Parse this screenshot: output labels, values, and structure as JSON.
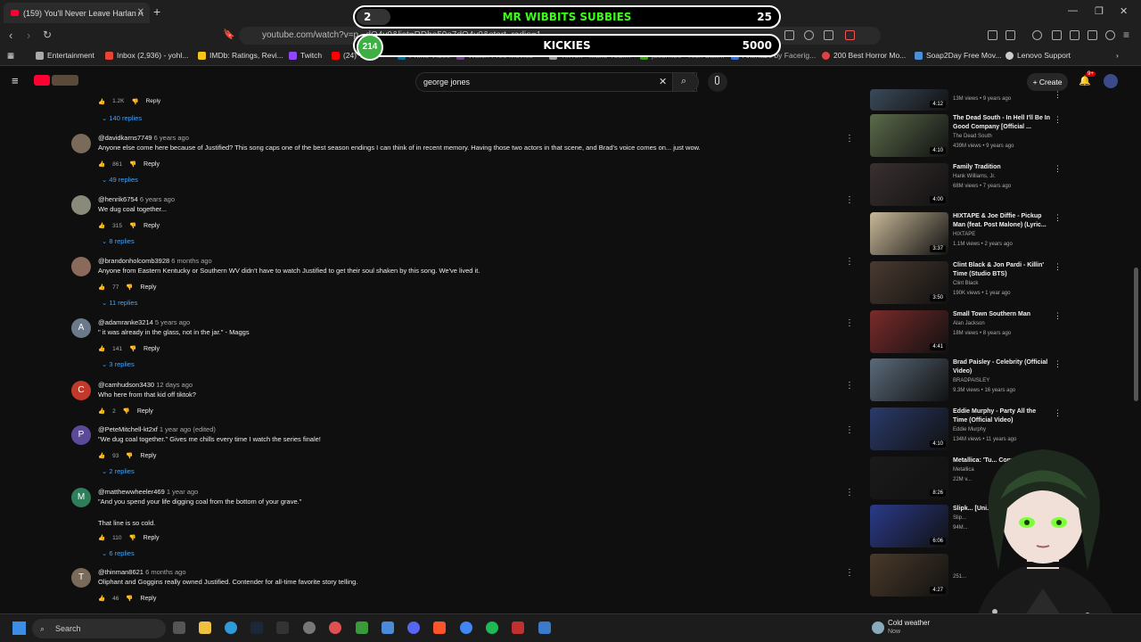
{
  "browser": {
    "tab_title": "(159) You'll Never Leave Harlan A",
    "url": "youtube.com/watch?v=p...dO4v0&list=RDhe50e7dO4v0&start_radio=1",
    "bookmarks": [
      {
        "label": "Entertainment",
        "color": "#aaaaaa"
      },
      {
        "label": "Inbox (2,936) - yohl...",
        "color": "#ea4335"
      },
      {
        "label": "IMDb: Ratings, Revi...",
        "color": "#f5c518"
      },
      {
        "label": "Twitch",
        "color": "#9146ff"
      },
      {
        "label": "(24) You...",
        "color": "#ff0000"
      },
      {
        "label": "Prime Video",
        "color": "#00a8e1"
      },
      {
        "label": "Watch Free Movies",
        "color": "#aa66cc"
      },
      {
        "label": "TikTok - Make Your...",
        "color": "#ffffff"
      },
      {
        "label": "jaesmise - Kick Stat...",
        "color": "#53fc18"
      },
      {
        "label": "Animaze by Facerig...",
        "color": "#4488ff"
      },
      {
        "label": "200 Best Horror Mo...",
        "color": "#e04040"
      },
      {
        "label": "Soap2Day Free Mov...",
        "color": "#4a90d9"
      },
      {
        "label": "Lenovo Support",
        "color": "#cccccc"
      }
    ]
  },
  "overlay": {
    "goal1": {
      "left": "2",
      "center": "MR WIBBITS SUBBIES",
      "right": "25",
      "color": "#39ff14",
      "progress": 0.08
    },
    "goal2": {
      "left": "214",
      "center": "KICKIES",
      "right": "5000",
      "color": "#ffffff",
      "progress": 0.04
    }
  },
  "youtube": {
    "search_value": "george jones",
    "create_label": "Create",
    "notif_count": "9+"
  },
  "top_fragment": {
    "likes": "1.2K",
    "reply": "Reply",
    "replies": "140 replies"
  },
  "comments": [
    {
      "handle": "@davidkarns7749",
      "time": "6 years ago",
      "text": "Anyone else come here because of Justified?  This song caps one of the best season endings I can think of in recent memory.  Having those two actors in that scene, and  Brad's voice comes on...  just wow.",
      "likes": "861",
      "reply": "Reply",
      "replies": "49 replies",
      "avatar_letter": "",
      "avatar_color": "#7a6a5a"
    },
    {
      "handle": "@henrik6754",
      "time": "6 years ago",
      "text": "We dug coal together...",
      "likes": "315",
      "reply": "Reply",
      "replies": "8 replies",
      "avatar_letter": "",
      "avatar_color": "#8a8a7a"
    },
    {
      "handle": "@brandonholcomb3928",
      "time": "6 months ago",
      "text": "Anyone from Eastern Kentucky or Southern WV didn't have to watch Justified to get their soul shaken by this song. We've lived it.",
      "likes": "77",
      "reply": "Reply",
      "replies": "11 replies",
      "avatar_letter": "",
      "avatar_color": "#8a6a5a"
    },
    {
      "handle": "@adamranke3214",
      "time": "5 years ago",
      "text": "\" it was already in the glass, not in the jar.\" - Maggs",
      "likes": "141",
      "reply": "Reply",
      "replies": "3 replies",
      "avatar_letter": "A",
      "avatar_color": "#6a7a8a"
    },
    {
      "handle": "@camhudson3430",
      "time": "12 days ago",
      "text": "Who here from that kid off tiktok?",
      "likes": "2",
      "reply": "Reply",
      "replies": "",
      "avatar_letter": "C",
      "avatar_color": "#c0392b"
    },
    {
      "handle": "@PeteMitchell-kt2xf",
      "time": "1 year ago (edited)",
      "text": "\"We dug coal together.\" Gives me chills every time I watch the series finale!",
      "likes": "93",
      "reply": "Reply",
      "replies": "2 replies",
      "avatar_letter": "P",
      "avatar_color": "#5b4a9a"
    },
    {
      "handle": "@matthewwheeler469",
      "time": "1 year ago",
      "text": "\"And you spend your life digging coal from the bottom of your grave.\"",
      "text2": "That line is so cold.",
      "likes": "110",
      "reply": "Reply",
      "replies": "6 replies",
      "avatar_letter": "M",
      "avatar_color": "#2e7d5b"
    },
    {
      "handle": "@thinman8621",
      "time": "6 months ago",
      "text": "Oliphant and Goggins really owned Justified.  Contender for all-time favorite story telling.",
      "likes": "46",
      "reply": "Reply",
      "replies": "",
      "avatar_letter": "T",
      "avatar_color": "#7a6a5a"
    }
  ],
  "sidebar": [
    {
      "title": "",
      "channel": "",
      "meta": "13M views • 9 years ago",
      "duration": "4:12",
      "thumb": "#3a4a5a"
    },
    {
      "title": "The Dead South - In Hell I'll Be In Good Company [Official ...",
      "channel": "The Dead South",
      "meta": "439M views • 9 years ago",
      "duration": "4:10",
      "thumb": "#5a6a4a"
    },
    {
      "title": "Family Tradition",
      "channel": "Hank Williams, Jr.",
      "meta": "68M views • 7 years ago",
      "duration": "4:00",
      "thumb": "#3a3030"
    },
    {
      "title": "HIXTAPE & Joe Diffie - Pickup Man (feat. Post Malone) (Lyric...",
      "channel": "HIXTAPE",
      "meta": "1.1M views • 2 years ago",
      "duration": "3:37",
      "thumb": "#c8b898"
    },
    {
      "title": "Clint Black & Jon Pardi - Killin' Time (Studio BTS)",
      "channel": "Clint Black",
      "meta": "190K views • 1 year ago",
      "duration": "3:50",
      "thumb": "#4a3a30"
    },
    {
      "title": "Small Town Southern Man",
      "channel": "Alan Jackson",
      "meta": "18M views • 8 years ago",
      "duration": "4:41",
      "thumb": "#7a2a2a"
    },
    {
      "title": "Brad Paisley - Celebrity (Official Video)",
      "channel": "BRADPAISLEY",
      "meta": "9.3M views • 16 years ago",
      "duration": "",
      "thumb": "#5a6a7a"
    },
    {
      "title": "Eddie Murphy - Party All the Time (Official Video)",
      "channel": "Eddie Murphy",
      "meta": "134M views • 11 years ago",
      "duration": "4:10",
      "thumb": "#2a3a6a"
    },
    {
      "title": "Metallica: 'Tu... Comes (O...",
      "channel": "Metallica",
      "meta": "22M v...",
      "duration": "8:26",
      "thumb": "#1a1a1a"
    },
    {
      "title": "Slipk... [Uni...",
      "channel": "Slip...",
      "meta": "94M...",
      "duration": "6:06",
      "thumb": "#2a3a8a"
    },
    {
      "title": "",
      "channel": "",
      "meta": "251...",
      "duration": "4:27",
      "thumb": "#4a3a2a"
    }
  ],
  "taskbar": {
    "search_label": "Search",
    "weather_title": "Cold weather",
    "weather_sub": "Now"
  }
}
